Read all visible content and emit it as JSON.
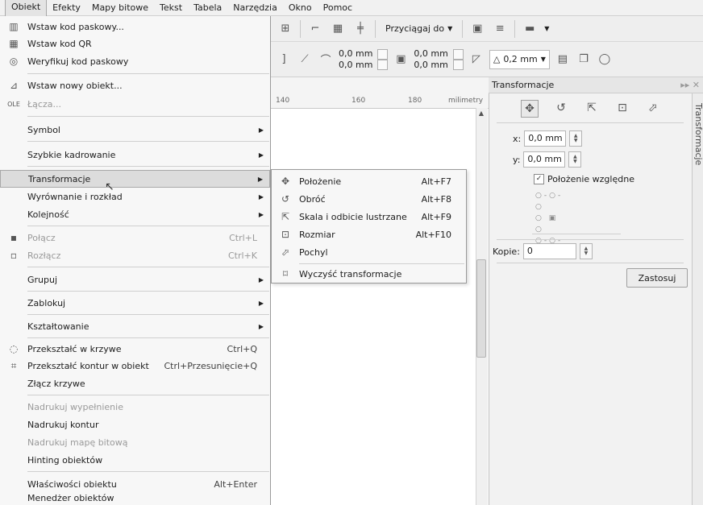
{
  "menubar": [
    "Obiekt",
    "Efekty",
    "Mapy bitowe",
    "Tekst",
    "Tabela",
    "Narzędzia",
    "Okno",
    "Pomoc"
  ],
  "toolbar1": {
    "snap_label": "Przyciągaj do"
  },
  "toolbar2": {
    "x1": "0,0 mm",
    "y1": "0,0 mm",
    "x2": "0,0 mm",
    "y2": "0,0 mm",
    "outline": "0,2 mm"
  },
  "ruler": {
    "t140": "140",
    "t160": "160",
    "t180": "180",
    "unit": "milimetry"
  },
  "menu": {
    "items": [
      {
        "label": "Wstaw kod paskowy...",
        "shortcut": "",
        "arrow": false,
        "disabled": false
      },
      {
        "label": "Wstaw kod QR",
        "shortcut": "",
        "arrow": false,
        "disabled": false
      },
      {
        "label": "Weryfikuj kod paskowy",
        "shortcut": "",
        "arrow": false,
        "disabled": false
      },
      {
        "label": "Wstaw nowy obiekt...",
        "shortcut": "",
        "arrow": false,
        "disabled": false
      },
      {
        "label": "Łącza...",
        "shortcut": "",
        "arrow": false,
        "disabled": true
      },
      {
        "label": "Symbol",
        "shortcut": "",
        "arrow": true,
        "disabled": false
      },
      {
        "label": "Szybkie kadrowanie",
        "shortcut": "",
        "arrow": true,
        "disabled": false
      },
      {
        "label": "Transformacje",
        "shortcut": "",
        "arrow": true,
        "disabled": false
      },
      {
        "label": "Wyrównanie i rozkład",
        "shortcut": "",
        "arrow": true,
        "disabled": false
      },
      {
        "label": "Kolejność",
        "shortcut": "",
        "arrow": true,
        "disabled": false
      },
      {
        "label": "Połącz",
        "shortcut": "Ctrl+L",
        "arrow": false,
        "disabled": true
      },
      {
        "label": "Rozłącz",
        "shortcut": "Ctrl+K",
        "arrow": false,
        "disabled": true
      },
      {
        "label": "Grupuj",
        "shortcut": "",
        "arrow": true,
        "disabled": false
      },
      {
        "label": "Zablokuj",
        "shortcut": "",
        "arrow": true,
        "disabled": false
      },
      {
        "label": "Kształtowanie",
        "shortcut": "",
        "arrow": true,
        "disabled": false
      },
      {
        "label": "Przekształć w krzywe",
        "shortcut": "Ctrl+Q",
        "arrow": false,
        "disabled": false
      },
      {
        "label": "Przekształć kontur w obiekt",
        "shortcut": "Ctrl+Przesunięcie+Q",
        "arrow": false,
        "disabled": false
      },
      {
        "label": "Złącz krzywe",
        "shortcut": "",
        "arrow": false,
        "disabled": false
      },
      {
        "label": "Nadrukuj wypełnienie",
        "shortcut": "",
        "arrow": false,
        "disabled": true
      },
      {
        "label": "Nadrukuj kontur",
        "shortcut": "",
        "arrow": false,
        "disabled": false
      },
      {
        "label": "Nadrukuj mapę bitową",
        "shortcut": "",
        "arrow": false,
        "disabled": true
      },
      {
        "label": "Hinting obiektów",
        "shortcut": "",
        "arrow": false,
        "disabled": false
      },
      {
        "label": "Właściwości obiektu",
        "shortcut": "Alt+Enter",
        "arrow": false,
        "disabled": false
      },
      {
        "label": "Menedżer obiektów",
        "shortcut": "",
        "arrow": false,
        "disabled": false
      }
    ]
  },
  "submenu": {
    "items": [
      {
        "label": "Położenie",
        "shortcut": "Alt+F7"
      },
      {
        "label": "Obróć",
        "shortcut": "Alt+F8"
      },
      {
        "label": "Skala i odbicie lustrzane",
        "shortcut": "Alt+F9"
      },
      {
        "label": "Rozmiar",
        "shortcut": "Alt+F10"
      },
      {
        "label": "Pochyl",
        "shortcut": ""
      },
      {
        "label": "Wyczyść transformacje",
        "shortcut": ""
      }
    ]
  },
  "docker": {
    "title": "Transformacje",
    "x_label": "x:",
    "x_value": "0,0 mm",
    "y_label": "y:",
    "y_value": "0,0 mm",
    "relative_label": "Położenie względne",
    "copies_label": "Kopie:",
    "copies_value": "0",
    "apply_label": "Zastosuj",
    "vertical_tab": "Transformacje"
  }
}
